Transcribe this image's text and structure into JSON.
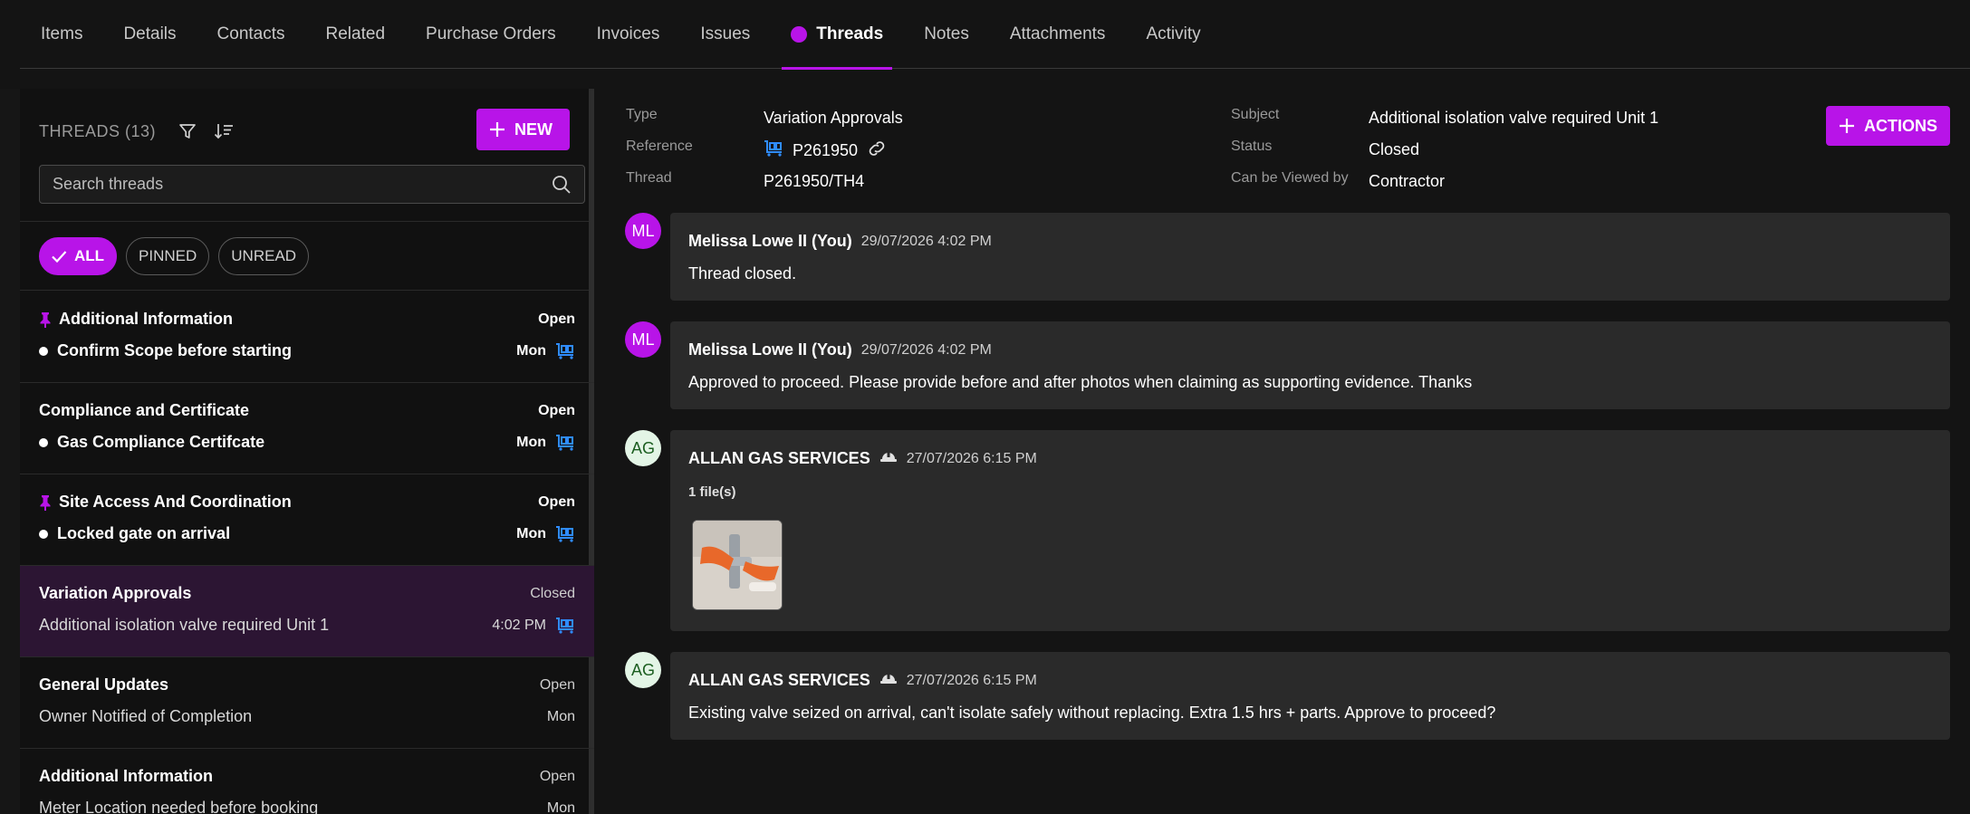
{
  "tabs": [
    {
      "label": "Items"
    },
    {
      "label": "Details"
    },
    {
      "label": "Contacts"
    },
    {
      "label": "Related"
    },
    {
      "label": "Purchase Orders"
    },
    {
      "label": "Invoices"
    },
    {
      "label": "Issues"
    },
    {
      "label": "Threads",
      "active": true
    },
    {
      "label": "Notes"
    },
    {
      "label": "Attachments"
    },
    {
      "label": "Activity"
    }
  ],
  "threads_panel": {
    "title": "THREADS (13)",
    "new_label": "NEW",
    "search_placeholder": "Search threads",
    "chips": [
      "ALL",
      "PINNED",
      "UNREAD"
    ],
    "items": [
      {
        "title": "Additional Information",
        "status": "Open",
        "subject": "Confirm Scope before starting",
        "time": "Mon",
        "pinned": true,
        "unread": true
      },
      {
        "title": "Compliance and Certificate",
        "status": "Open",
        "subject": "Gas Compliance Certifcate",
        "time": "Mon",
        "pinned": false,
        "unread": true
      },
      {
        "title": "Site Access And Coordination",
        "status": "Open",
        "subject": "Locked gate on arrival",
        "time": "Mon",
        "pinned": true,
        "unread": true
      },
      {
        "title": "Variation Approvals",
        "status": "Closed",
        "subject": "Additional isolation valve required Unit 1",
        "time": "4:02 PM",
        "selected": true
      },
      {
        "title": "General Updates",
        "status": "Open",
        "subject": "Owner Notified of Completion",
        "time": "Mon"
      },
      {
        "title": "Additional Information",
        "status": "Open",
        "subject": "Meter Location needed before booking",
        "time": "Mon"
      }
    ]
  },
  "detail": {
    "type_label": "Type",
    "type_value": "Variation Approvals",
    "reference_label": "Reference",
    "reference_value": "P261950",
    "thread_label": "Thread",
    "thread_value": "P261950/TH4",
    "subject_label": "Subject",
    "subject_value": "Additional isolation valve required Unit 1",
    "status_label": "Status",
    "status_value": "Closed",
    "viewers_label": "Can be Viewed by",
    "viewers_value": "Contractor",
    "actions_label": "ACTIONS"
  },
  "messages": [
    {
      "initials": "ML",
      "author": "Melissa Lowe II (You)",
      "date": "29/07/2026 4:02 PM",
      "body": "Thread closed."
    },
    {
      "initials": "ML",
      "author": "Melissa Lowe II (You)",
      "date": "29/07/2026 4:02 PM",
      "body": "Approved to proceed. Please provide before and after photos when claiming as supporting evidence. Thanks"
    },
    {
      "initials": "AG",
      "author": "ALLAN GAS SERVICES",
      "date": "27/07/2026 6:15 PM",
      "files": "1 file(s)"
    },
    {
      "initials": "AG",
      "author": "ALLAN GAS SERVICES",
      "date": "27/07/2026 6:15 PM",
      "body": "Existing valve seized on arrival, can't isolate safely without replacing. Extra 1.5 hrs + parts. Approve to proceed?"
    }
  ],
  "colors": {
    "accent": "#b814e8",
    "background": "#141414",
    "bubble": "#2a2a2a",
    "selected_row": "#2c1533",
    "cart_icon": "#2f8cff"
  }
}
